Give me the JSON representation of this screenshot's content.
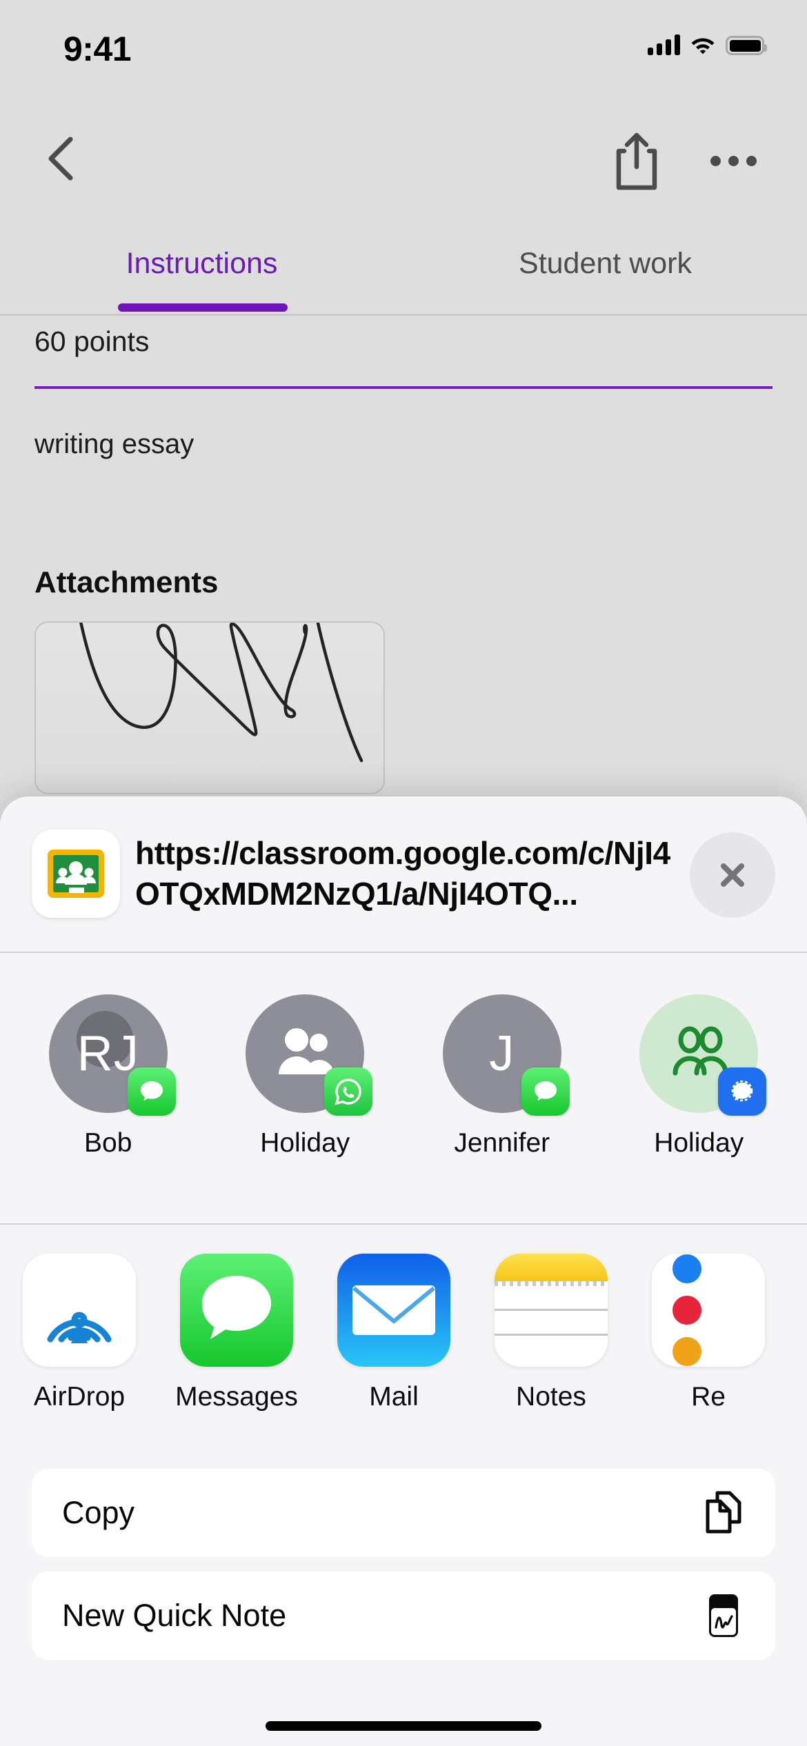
{
  "status_bar": {
    "time": "9:41",
    "signal_icon": "cellular-signal-icon",
    "wifi_icon": "wifi-icon",
    "battery_icon": "battery-full-icon"
  },
  "nav_bar": {
    "back_icon": "chevron-left-icon",
    "share_icon": "share-icon",
    "more_icon": "more-horizontal-icon"
  },
  "tabs": [
    {
      "label": "Instructions",
      "active": true
    },
    {
      "label": "Student work",
      "active": false
    }
  ],
  "assignment": {
    "points": "60 points",
    "description": "writing essay",
    "attachments_heading": "Attachments",
    "attachment_type": "handwritten-scribble-thumbnail"
  },
  "share_sheet": {
    "preview": {
      "app_icon": "google-classroom-icon",
      "url": "https://classroom.google.com/c/NjI4OTQxMDM2NzQ1/a/NjI4OTQ...",
      "close_icon": "close-circle-icon"
    },
    "contacts": [
      {
        "name": "Bob",
        "initials": "RJ",
        "avatar_kind": "initials-with-photo",
        "badge": "messages-icon"
      },
      {
        "name": "Holiday",
        "initials": "",
        "avatar_kind": "group-icon",
        "badge": "whatsapp-icon"
      },
      {
        "name": "Jennifer",
        "initials": "J",
        "avatar_kind": "initials",
        "badge": "messages-icon"
      },
      {
        "name": "Holiday",
        "initials": "",
        "avatar_kind": "group-icon-green",
        "badge": "signal-icon"
      }
    ],
    "apps": [
      {
        "label": "AirDrop",
        "icon": "airdrop-icon"
      },
      {
        "label": "Messages",
        "icon": "messages-icon"
      },
      {
        "label": "Mail",
        "icon": "mail-icon"
      },
      {
        "label": "Notes",
        "icon": "notes-icon"
      },
      {
        "label": "Re",
        "icon": "reminders-icon"
      }
    ],
    "actions": [
      {
        "label": "Copy",
        "icon": "copy-icon"
      },
      {
        "label": "New Quick Note",
        "icon": "quick-note-icon"
      }
    ]
  },
  "colors": {
    "accent_purple": "#6f13ba",
    "sheet_background": "#f5f5f7",
    "app_background": "#dededf",
    "messages_green": "#16c72e",
    "signal_blue": "#1f6ff0",
    "mail_blue": "#1e9bf0",
    "notes_yellow": "#f5c518",
    "classroom_green": "#1e8e3e",
    "classroom_yellow": "#f4b400"
  }
}
